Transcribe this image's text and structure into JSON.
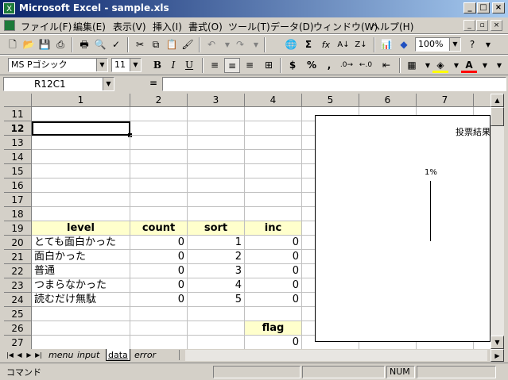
{
  "window": {
    "title": "Microsoft Excel - sample.xls",
    "app_icon_label": "X"
  },
  "menu": [
    "ファイル(F)",
    "編集(E)",
    "表示(V)",
    "挿入(I)",
    "書式(O)",
    "ツール(T)",
    "データ(D)",
    "ウィンドウ(W)",
    "ヘルプ(H)"
  ],
  "toolbar": {
    "zoom": "100%",
    "sum_glyph": "Σ",
    "fx_glyph": "fx",
    "font_name": "MS Pゴシック",
    "font_size": "11",
    "bold": "B",
    "italic": "I",
    "underline": "U",
    "currency": "$",
    "percent": "%",
    "comma": ",",
    "font_color_letter": "A"
  },
  "formula_bar": {
    "name_box": "R12C1",
    "equals": "=",
    "content": ""
  },
  "columns": [
    "1",
    "2",
    "3",
    "4",
    "5",
    "6",
    "7"
  ],
  "rows": [
    "11",
    "12",
    "13",
    "14",
    "15",
    "16",
    "17",
    "18",
    "19",
    "20",
    "21",
    "22",
    "23",
    "24",
    "25",
    "26",
    "27"
  ],
  "table": {
    "headers": {
      "level": "level",
      "count": "count",
      "sort": "sort",
      "inc": "inc"
    },
    "rows": [
      {
        "level": "とても面白かった",
        "count": "0",
        "sort": "1",
        "inc": "0"
      },
      {
        "level": "面白かった",
        "count": "0",
        "sort": "2",
        "inc": "0"
      },
      {
        "level": "普通",
        "count": "0",
        "sort": "3",
        "inc": "0"
      },
      {
        "level": "つまらなかった",
        "count": "0",
        "sort": "4",
        "inc": "0"
      },
      {
        "level": "読むだけ無駄",
        "count": "0",
        "sort": "5",
        "inc": "0"
      }
    ],
    "flag_label": "flag",
    "flag_value": "0"
  },
  "chart": {
    "title": "投票結果",
    "label": "1%"
  },
  "sheets": [
    "menu",
    "input",
    "data",
    "error"
  ],
  "active_sheet": "data",
  "status": {
    "mode": "コマンド",
    "num": "NUM"
  },
  "colors": {
    "header_fill": "#ffffcc",
    "title_start": "#0a246a",
    "title_end": "#a6caf0"
  }
}
